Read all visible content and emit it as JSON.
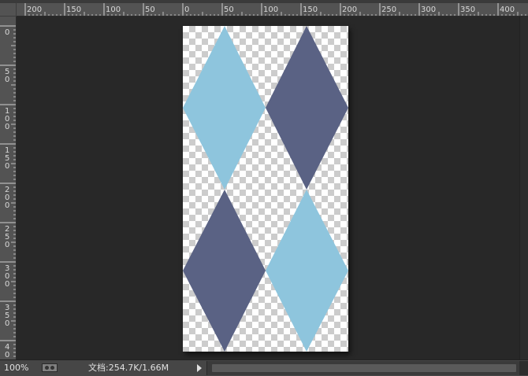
{
  "rulers": {
    "horizontal_labels": [
      "200",
      "150",
      "100",
      "50",
      "0",
      "50",
      "100",
      "150",
      "200",
      "250",
      "300",
      "350",
      "400"
    ],
    "vertical_labels": [
      [
        "0"
      ],
      [
        "5",
        "0"
      ],
      [
        "1",
        "0",
        "0"
      ],
      [
        "1",
        "5",
        "0"
      ],
      [
        "2",
        "0",
        "0"
      ],
      [
        "2",
        "5",
        "0"
      ],
      [
        "3",
        "0",
        "0"
      ],
      [
        "3",
        "5",
        "0"
      ],
      [
        "4",
        "0"
      ]
    ]
  },
  "document": {
    "background": "transparent-checkerboard",
    "shapes": [
      {
        "name": "diamond-top-left",
        "color": "#8ec5dd"
      },
      {
        "name": "diamond-top-right",
        "color": "#5a6284"
      },
      {
        "name": "diamond-bottom-left",
        "color": "#5a6284"
      },
      {
        "name": "diamond-bottom-right",
        "color": "#8ec5dd"
      }
    ]
  },
  "status_bar": {
    "zoom": "100%",
    "doc_info": "文档:254.7K/1.66M",
    "icon": "document-profile-icon",
    "arrow_icon": "menu-arrow-icon"
  },
  "colors": {
    "workspace": "#282828",
    "ruler": "#535353",
    "light_blue": "#8ec5dd",
    "slate_blue": "#5a6284"
  }
}
